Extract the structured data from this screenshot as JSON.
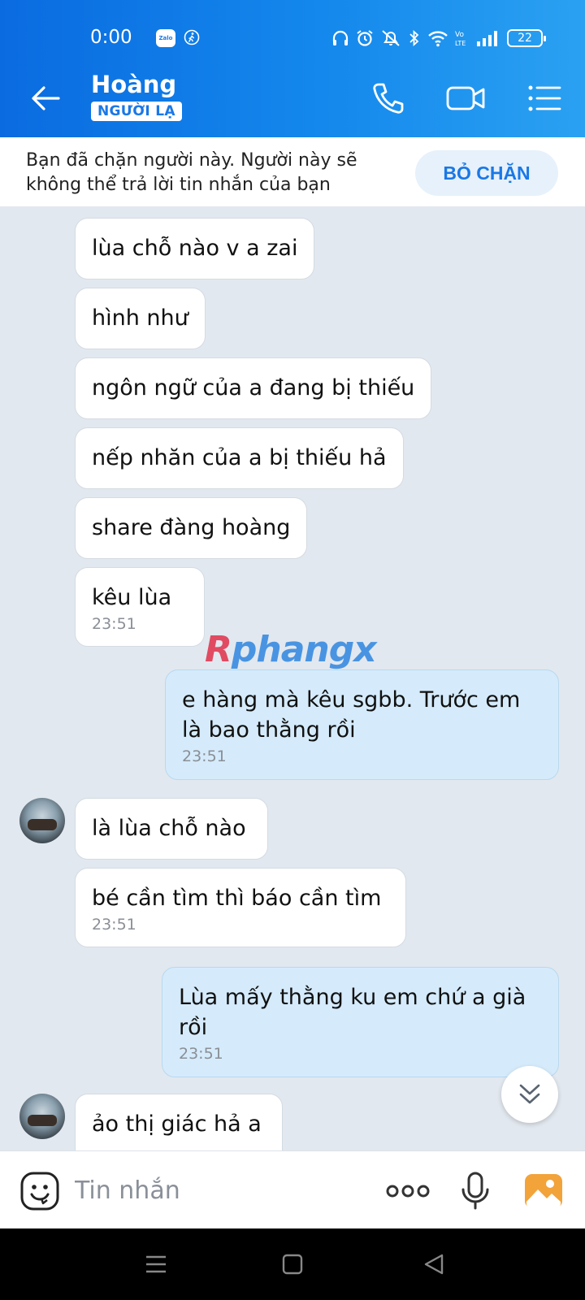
{
  "status_bar": {
    "time": "0:00",
    "zalo_label": "Zalo",
    "battery": "22"
  },
  "header": {
    "contact_name": "Hoàng",
    "badge": "NGƯỜI LẠ"
  },
  "banner": {
    "text": "Bạn đã chặn người này. Người này sẽ không thể trả lời tin nhắn của bạn",
    "unblock_label": "BỎ CHẶN"
  },
  "messages": [
    {
      "from": "them",
      "text": "lùa chỗ nào v a zai"
    },
    {
      "from": "them",
      "text": "hình như"
    },
    {
      "from": "them",
      "text": "ngôn ngữ của a đang bị thiếu"
    },
    {
      "from": "them",
      "text": "nếp nhăn của a bị thiếu hả"
    },
    {
      "from": "them",
      "text": "share đàng hoàng"
    },
    {
      "from": "them",
      "text": "kêu lùa",
      "time": "23:51"
    },
    {
      "from": "me",
      "text_lines": [
        "e hàng mà kêu sgbb. Trước em",
        "là bao thằng rồi"
      ],
      "time": "23:51"
    },
    {
      "from": "them",
      "text": "là lùa chỗ nào"
    },
    {
      "from": "them",
      "text": "bé cần tìm thì báo cần tìm",
      "time": "23:51"
    },
    {
      "from": "me",
      "text_lines": [
        "Lùa mấy thằng ku em chứ a già",
        "rồi"
      ],
      "time": "23:51"
    },
    {
      "from": "them",
      "text": "ảo thị giác hả a"
    }
  ],
  "watermark": {
    "part1": "R",
    "part2": "phangx"
  },
  "composer": {
    "placeholder": "Tin nhắn"
  },
  "colors": {
    "header_start": "#0a6be0",
    "header_end": "#2ba1f2",
    "my_bubble": "#d5ebfb",
    "accent": "#1a78e6"
  }
}
